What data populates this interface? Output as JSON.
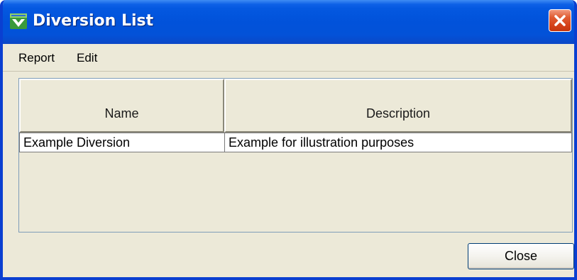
{
  "window": {
    "title": "Diversion List",
    "titlebar_color": "#0152da",
    "close_button_color": "#d6421a",
    "icon": "diversion-app-icon"
  },
  "menu": {
    "items": [
      {
        "label": "Report"
      },
      {
        "label": "Edit"
      }
    ]
  },
  "table": {
    "columns": [
      "Name",
      "Description"
    ],
    "rows": [
      {
        "name": "Example Diversion",
        "description": "Example for illustration purposes"
      }
    ]
  },
  "buttons": {
    "close_label": "Close"
  }
}
